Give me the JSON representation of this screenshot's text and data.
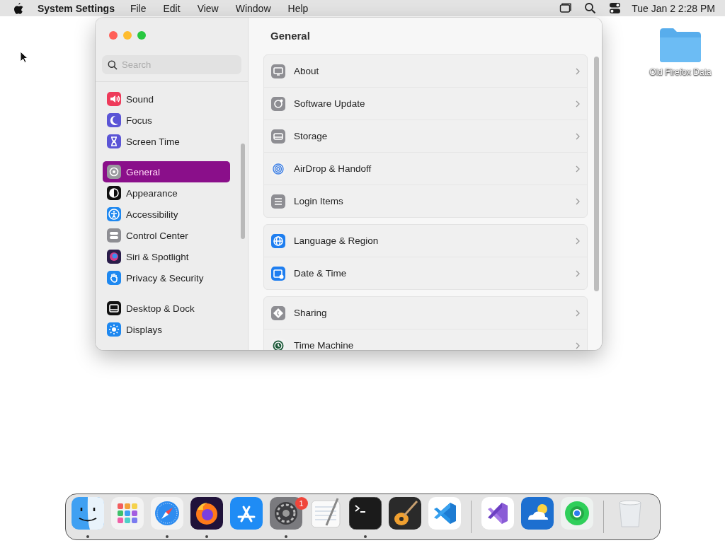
{
  "menu_bar": {
    "app_name": "System Settings",
    "menus": [
      "File",
      "Edit",
      "View",
      "Window",
      "Help"
    ],
    "status_icons": [
      {
        "kind": "windows"
      },
      {
        "kind": "search"
      },
      {
        "kind": "controls"
      }
    ],
    "clock": "Tue Jan 2  2:28 PM"
  },
  "desktop": {
    "items": [
      {
        "label": "Old Firefox Data",
        "kind": "folder"
      }
    ]
  },
  "window": {
    "search": {
      "placeholder": "Search"
    },
    "sidebar": {
      "groups": [
        {
          "items": [
            {
              "label": "Sound",
              "kind": "sound",
              "selected": false
            },
            {
              "label": "Focus",
              "kind": "focus",
              "selected": false
            },
            {
              "label": "Screen Time",
              "kind": "screentime",
              "selected": false
            }
          ]
        },
        {
          "items": [
            {
              "label": "General",
              "kind": "general",
              "selected": true
            },
            {
              "label": "Appearance",
              "kind": "appearance",
              "selected": false
            },
            {
              "label": "Accessibility",
              "kind": "accessibility",
              "selected": false
            },
            {
              "label": "Control Center",
              "kind": "controlcenter",
              "selected": false
            },
            {
              "label": "Siri & Spotlight",
              "kind": "siri",
              "selected": false
            },
            {
              "label": "Privacy & Security",
              "kind": "privacy",
              "selected": false
            }
          ]
        },
        {
          "items": [
            {
              "label": "Desktop & Dock",
              "kind": "desktop",
              "selected": false
            },
            {
              "label": "Displays",
              "kind": "displays",
              "selected": false
            }
          ]
        }
      ]
    },
    "content": {
      "title": "General",
      "groups": [
        {
          "rows": [
            {
              "label": "About",
              "kind": "about"
            },
            {
              "label": "Software Update",
              "kind": "update"
            },
            {
              "label": "Storage",
              "kind": "storage"
            },
            {
              "label": "AirDrop & Handoff",
              "kind": "airdrop"
            },
            {
              "label": "Login Items",
              "kind": "login"
            }
          ]
        },
        {
          "rows": [
            {
              "label": "Language & Region",
              "kind": "language"
            },
            {
              "label": "Date & Time",
              "kind": "datetime"
            }
          ]
        },
        {
          "rows": [
            {
              "label": "Sharing",
              "kind": "sharing"
            },
            {
              "label": "Time Machine",
              "kind": "timemachine"
            }
          ]
        }
      ]
    }
  },
  "dock": {
    "sections": [
      {
        "apps": [
          {
            "kind": "finder",
            "running": true
          },
          {
            "kind": "launchpad",
            "running": false
          },
          {
            "kind": "safari",
            "running": true
          },
          {
            "kind": "firefox",
            "running": true
          },
          {
            "kind": "appstore",
            "running": false
          },
          {
            "kind": "settings",
            "running": true,
            "badge": "1"
          },
          {
            "kind": "textedit",
            "running": false
          },
          {
            "kind": "terminal",
            "running": true
          },
          {
            "kind": "garageband",
            "running": false
          },
          {
            "kind": "vscode",
            "running": false
          }
        ]
      },
      {
        "apps": [
          {
            "kind": "visualstudio",
            "running": false
          },
          {
            "kind": "weather",
            "running": false
          },
          {
            "kind": "findmy",
            "running": false
          }
        ]
      },
      {
        "apps": [
          {
            "kind": "trash",
            "running": false
          }
        ]
      }
    ]
  }
}
